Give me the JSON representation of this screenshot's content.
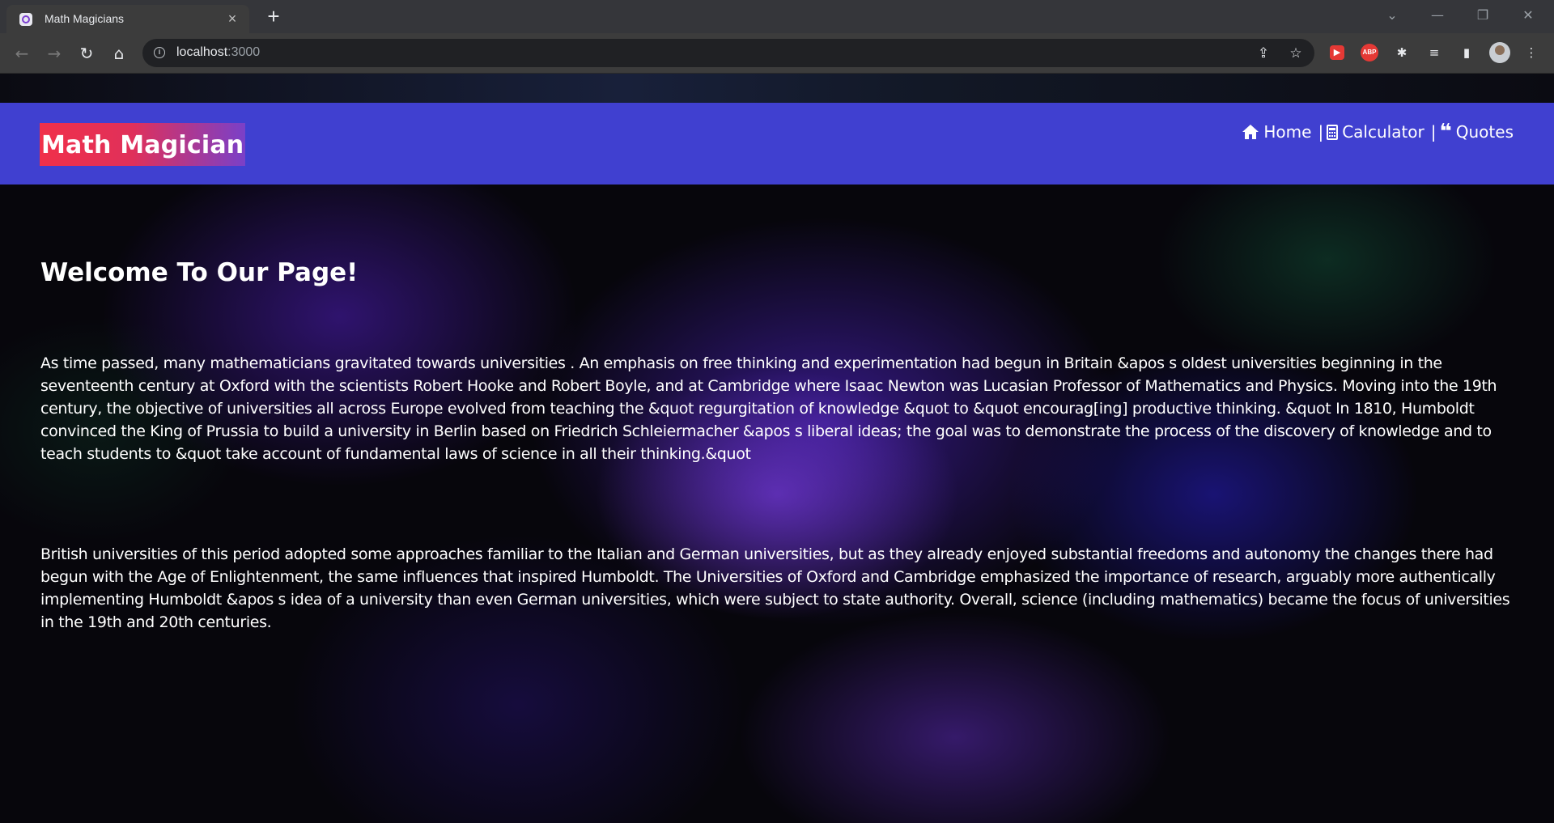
{
  "browser": {
    "tab_title": "Math Magicians",
    "tab_close": "×",
    "new_tab": "+",
    "url_host": "localhost",
    "url_port": ":3000",
    "window_controls": {
      "dropdown": "⌄",
      "minimize": "—",
      "restore": "❐",
      "close": "✕"
    },
    "nav": {
      "back": "←",
      "forward": "→",
      "reload": "↻",
      "home": "⌂"
    },
    "omnibox_icons": {
      "share": "⇪",
      "bookmark": "☆"
    },
    "extensions": {
      "ext1": "▶",
      "abp": "ABP",
      "puzzle": "✱",
      "media": "≡",
      "sidepanel": "▮",
      "menu": "⋮"
    }
  },
  "header": {
    "logo": "Math Magician",
    "nav": [
      {
        "icon": "home-icon",
        "label": "Home"
      },
      {
        "icon": "calculator-icon",
        "label": "Calculator"
      },
      {
        "icon": "quote-icon",
        "label": "Quotes"
      }
    ],
    "separator": "|",
    "quote_glyph": "❝"
  },
  "main": {
    "heading": "Welcome To Our Page!",
    "paragraphs": [
      "As time passed, many mathematicians gravitated towards universities . An emphasis on free thinking and experimentation had begun in Britain &apos s oldest universities beginning in the seventeenth century at Oxford with the scientists Robert Hooke and Robert Boyle, and at Cambridge where Isaac Newton was Lucasian Professor of Mathematics and Physics. Moving into the 19th century, the objective of universities all across Europe evolved from teaching the &quot regurgitation of knowledge &quot to &quot encourag[ing] productive thinking. &quot In 1810, Humboldt convinced the King of Prussia to build a university in Berlin based on Friedrich Schleiermacher &apos s liberal ideas; the goal was to demonstrate the process of the discovery of knowledge and to teach students to &quot take account of fundamental laws of science in all their thinking.&quot",
      "British universities of this period adopted some approaches familiar to the Italian and German universities, but as they already enjoyed substantial freedoms and autonomy the changes there had begun with the Age of Enlightenment, the same influences that inspired Humboldt. The Universities of Oxford and Cambridge emphasized the importance of research, arguably more authentically implementing Humboldt &apos s idea of a university than even German universities, which were subject to state authority. Overall, science (including mathematics) became the focus of universities in the 19th and 20th centuries."
    ]
  },
  "colors": {
    "header_bg": "#4040d0",
    "logo_gradient_start": "#f0304a",
    "logo_gradient_end": "#7a40c8",
    "text": "#ffffff",
    "chrome_bg": "#35363a"
  }
}
